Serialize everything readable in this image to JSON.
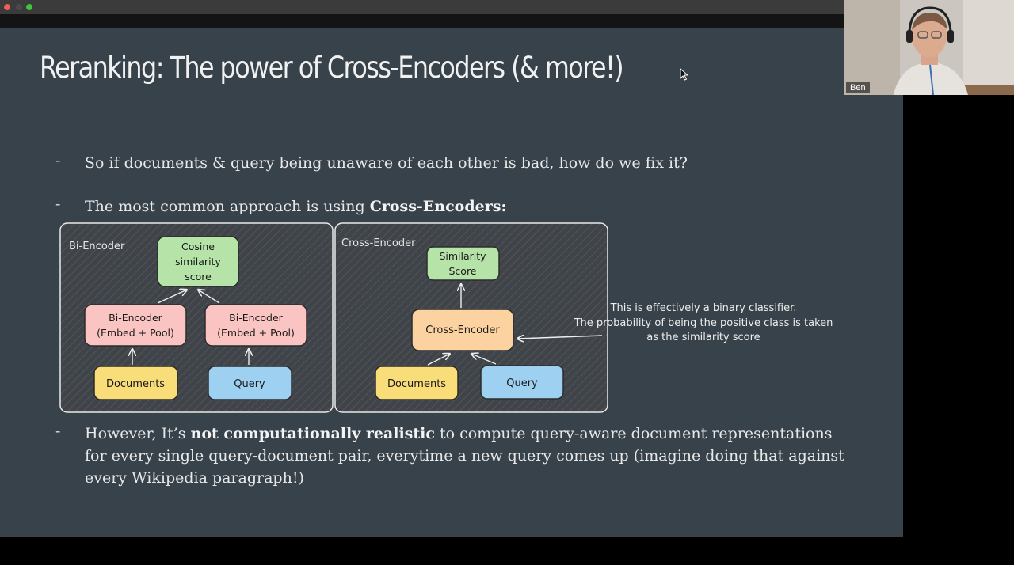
{
  "window": {
    "controls": [
      {
        "name": "close",
        "color": "#ed5f57"
      },
      {
        "name": "minimize",
        "color": "#4a4a4a"
      },
      {
        "name": "maximize",
        "color": "#3cc640"
      }
    ]
  },
  "slide": {
    "title": "Reranking: The power of Cross-Encoders (& more!)",
    "bullets": [
      {
        "dash": "-",
        "text": "So if documents & query being unaware of each other is bad, how do we fix it?"
      },
      {
        "dash": "-",
        "prefix": "The most common approach is using ",
        "bold": "Cross-Encoders:"
      },
      {
        "dash": "-",
        "prefix": "However, It’s ",
        "bold": "not computationally realistic",
        "suffix": " to compute query-aware document representations for every single query-document pair, everytime a new query comes up (imagine doing that against every Wikipedia paragraph!)"
      }
    ],
    "diagram": {
      "bi_encoder": {
        "label": "Bi-Encoder",
        "cosine_line1": "Cosine",
        "cosine_line2": "similarity",
        "cosine_line3": "score",
        "encoder_line1": "Bi-Encoder",
        "encoder_line2": "(Embed + Pool)",
        "documents": "Documents",
        "query": "Query"
      },
      "cross_encoder": {
        "label": "Cross-Encoder",
        "score_line1": "Similarity",
        "score_line2": "Score",
        "encoder": "Cross-Encoder",
        "documents": "Documents",
        "query": "Query"
      },
      "annotation": {
        "line1": "This is effectively a binary classifier.",
        "line2": "The probability of being the positive class is taken",
        "line3": "as the similarity score"
      },
      "colors": {
        "green": "#b6e3a7",
        "pink": "#f9c4c1",
        "yellow": "#f8dd79",
        "blue": "#9ed0f2",
        "orange": "#fcd3a0"
      }
    }
  },
  "webcam": {
    "name_label": "Ben"
  }
}
